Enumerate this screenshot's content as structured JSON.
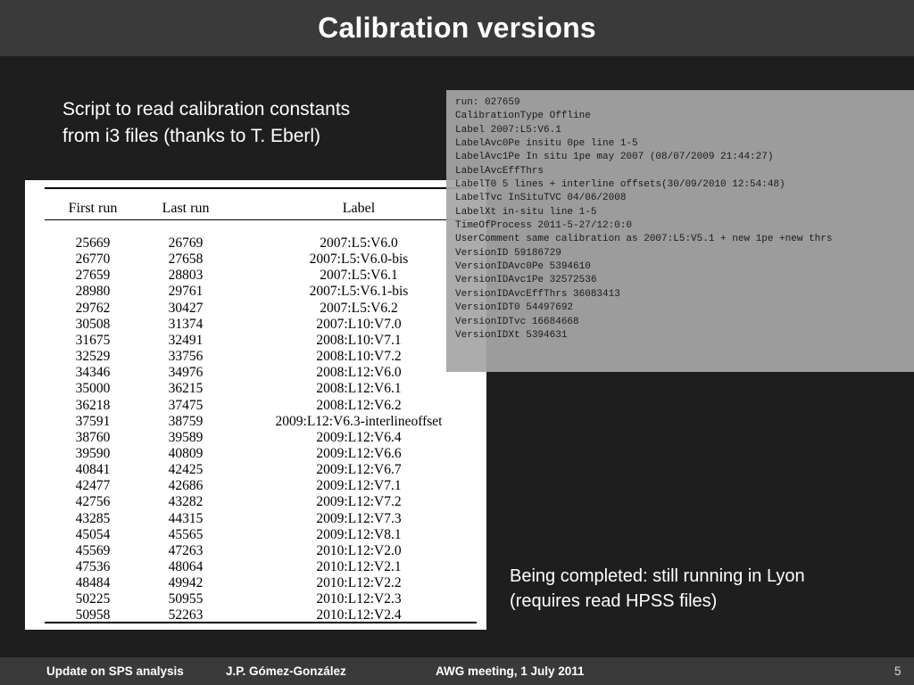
{
  "slide": {
    "title": "Calibration versions",
    "intro_lines": [
      "Script to read calibration constants",
      "from i3 files (thanks to T. Eberl)"
    ],
    "status_lines": [
      "Being completed: still running in Lyon",
      "(requires read HPSS files)"
    ]
  },
  "table": {
    "headers": [
      "First run",
      "Last run",
      "Label"
    ],
    "rows": [
      [
        "25669",
        "26769",
        "2007:L5:V6.0"
      ],
      [
        "26770",
        "27658",
        "2007:L5:V6.0-bis"
      ],
      [
        "27659",
        "28803",
        "2007:L5:V6.1"
      ],
      [
        "28980",
        "29761",
        "2007:L5:V6.1-bis"
      ],
      [
        "29762",
        "30427",
        "2007:L5:V6.2"
      ],
      [
        "30508",
        "31374",
        "2007:L10:V7.0"
      ],
      [
        "31675",
        "32491",
        "2008:L10:V7.1"
      ],
      [
        "32529",
        "33756",
        "2008:L10:V7.2"
      ],
      [
        "34346",
        "34976",
        "2008:L12:V6.0"
      ],
      [
        "35000",
        "36215",
        "2008:L12:V6.1"
      ],
      [
        "36218",
        "37475",
        "2008:L12:V6.2"
      ],
      [
        "37591",
        "38759",
        "2009:L12:V6.3-interlineoffset"
      ],
      [
        "38760",
        "39589",
        "2009:L12:V6.4"
      ],
      [
        "39590",
        "40809",
        "2009:L12:V6.6"
      ],
      [
        "40841",
        "42425",
        "2009:L12:V6.7"
      ],
      [
        "42477",
        "42686",
        "2009:L12:V7.1"
      ],
      [
        "42756",
        "43282",
        "2009:L12:V7.2"
      ],
      [
        "43285",
        "44315",
        "2009:L12:V7.3"
      ],
      [
        "45054",
        "45565",
        "2009:L12:V8.1"
      ],
      [
        "45569",
        "47263",
        "2010:L12:V2.0"
      ],
      [
        "47536",
        "48064",
        "2010:L12:V2.1"
      ],
      [
        "48484",
        "49942",
        "2010:L12:V2.2"
      ],
      [
        "50225",
        "50955",
        "2010:L12:V2.3"
      ],
      [
        "50958",
        "52263",
        "2010:L12:V2.4"
      ]
    ]
  },
  "code_lines": [
    "run: 027659",
    "CalibrationType Offline",
    "Label 2007:L5:V6.1",
    "LabelAvc0Pe insitu 0pe line 1-5",
    "LabelAvc1Pe In situ 1pe may 2007 (08/07/2009 21:44:27)",
    "LabelAvcEffThrs",
    "LabelT0 5 lines + interline offsets(30/09/2010 12:54:48)",
    "LabelTvc InSituTVC 04/06/2008",
    "LabelXt in-situ line 1-5",
    "TimeOfProcess 2011-5-27/12:0:0",
    "UserComment same calibration as 2007:L5:V5.1 + new 1pe +new thrs",
    "VersionID 59186729",
    "VersionIDAvc0Pe 5394610",
    "VersionIDAvc1Pe 32572536",
    "VersionIDAvcEffThrs 36083413",
    "VersionIDT0 54497692",
    "VersionIDTvc 16684668",
    "VersionIDXt 5394631"
  ],
  "footer": {
    "talk": "Update on SPS analysis",
    "author": "J.P. Gómez-González",
    "meeting": "AWG meeting, 1 July 2011",
    "page": "5"
  }
}
